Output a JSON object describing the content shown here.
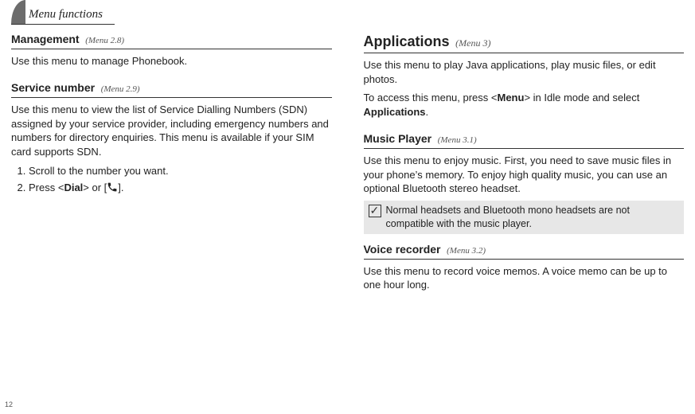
{
  "page_number": "12",
  "header": {
    "title": "Menu functions"
  },
  "left": {
    "management": {
      "title": "Management",
      "ref": "(Menu 2.8)",
      "p1": "Use this menu to manage Phonebook."
    },
    "service_number": {
      "title": "Service number",
      "ref": "(Menu 2.9)",
      "p1": "Use this menu to view the list of Service Dialling Numbers (SDN) assigned by your service provider, including emergency numbers and numbers for directory enquiries. This menu is available if your SIM card supports SDN.",
      "step1": "Scroll to the number you want.",
      "step2_prefix": "Press <",
      "step2_bold": "Dial",
      "step2_suffix": "> or [",
      "step2_tail": "]."
    }
  },
  "right": {
    "applications": {
      "title": "Applications",
      "ref": "(Menu 3)",
      "p1": "Use this menu to play Java applications, play music files, or edit photos.",
      "p2_prefix": "To access this menu, press <",
      "p2_bold1": "Menu",
      "p2_mid": "> in Idle mode and select ",
      "p2_bold2": "Applications",
      "p2_suffix": "."
    },
    "music_player": {
      "title": "Music Player",
      "ref": "(Menu 3.1)",
      "p1": "Use this menu to enjoy music. First, you need to save music files in your phone’s memory. To enjoy high quality music, you can use an optional Bluetooth stereo headset.",
      "note": "Normal headsets and Bluetooth mono headsets are not compatible with the music player."
    },
    "voice_recorder": {
      "title": "Voice recorder",
      "ref": "(Menu 3.2)",
      "p1": "Use this menu to record voice memos. A voice memo can be up to one hour long."
    }
  }
}
